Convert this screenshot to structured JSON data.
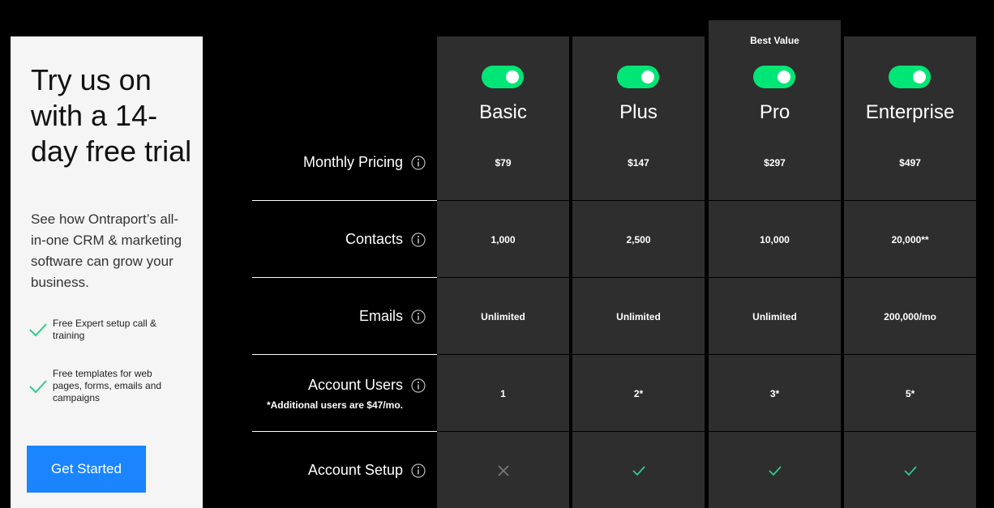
{
  "trial": {
    "headline": "Try us on with a 14-day free trial",
    "description": "See how Ontraport’s all-in-one CRM & marketing software can grow your business.",
    "features": [
      "Free Expert setup call & training",
      "Free templates for web pages, forms, emails and campaigns"
    ],
    "cta_label": "Get Started"
  },
  "colors": {
    "accent_green": "#00e676",
    "check_green": "#2ecc8f",
    "cta_blue": "#1a85ff",
    "column_bg": "#2e2e2e",
    "panel_bg": "#f5f5f5"
  },
  "plans": [
    {
      "name": "Basic",
      "badge": "",
      "price": "$79",
      "contacts": "1,000",
      "emails": "Unlimited",
      "users": "1",
      "setup": "no"
    },
    {
      "name": "Plus",
      "badge": "",
      "price": "$147",
      "contacts": "2,500",
      "emails": "Unlimited",
      "users": "2*",
      "setup": "yes"
    },
    {
      "name": "Pro",
      "badge": "Best Value",
      "price": "$297",
      "contacts": "10,000",
      "emails": "Unlimited",
      "users": "3*",
      "setup": "yes"
    },
    {
      "name": "Enterprise",
      "badge": "",
      "price": "$497",
      "contacts": "20,000**",
      "emails": "200,000/mo",
      "users": "5*",
      "setup": "yes"
    }
  ],
  "rows": [
    {
      "key": "price",
      "label": "Monthly Pricing",
      "note": ""
    },
    {
      "key": "contacts",
      "label": "Contacts",
      "note": ""
    },
    {
      "key": "emails",
      "label": "Emails",
      "note": ""
    },
    {
      "key": "users",
      "label": "Account Users",
      "note": "*Additional users are $47/mo."
    },
    {
      "key": "setup",
      "label": "Account Setup",
      "note": ""
    }
  ],
  "icons": {
    "info": "info-circle-icon",
    "check": "check-icon",
    "cross": "x-icon",
    "toggle": "toggle-switch"
  }
}
